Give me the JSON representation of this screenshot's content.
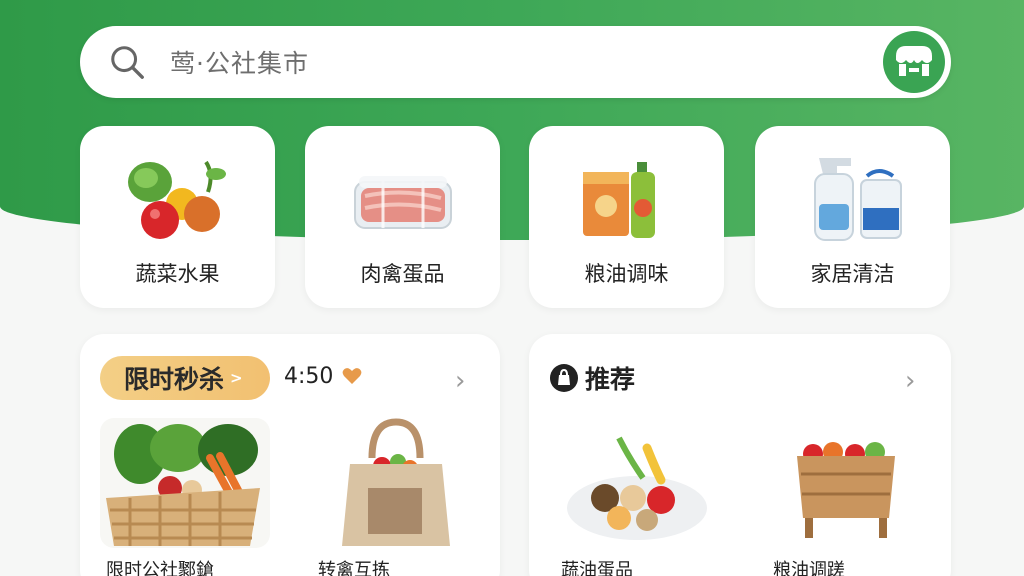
{
  "search": {
    "placeholder": "莺·公社集市",
    "icons": {
      "left": "search-icon",
      "right": "storefront-icon"
    }
  },
  "categories": [
    {
      "label": "蔬菜水果",
      "icon": "vegetables-fruits-icon"
    },
    {
      "label": "肉禽蛋品",
      "icon": "meat-tray-icon"
    },
    {
      "label": "粮油调味",
      "icon": "grain-oil-icon"
    },
    {
      "label": "家居清洁",
      "icon": "cleaning-bottles-icon"
    }
  ],
  "flash_sale": {
    "title": "限时秒杀",
    "timer": "4:50",
    "products": [
      {
        "label": "限时公社鄹鎗",
        "image": "vegetable-basket"
      },
      {
        "label": "转禽互拣",
        "image": "grocery-tote-bag"
      }
    ]
  },
  "recommend": {
    "title": "推荐",
    "products": [
      {
        "label": "蔬油蛋品",
        "image": "vegetable-plate"
      },
      {
        "label": "粮油调蹉",
        "image": "fruit-crate"
      }
    ]
  },
  "colors": {
    "brand_green": "#3ea857",
    "pill_gold": "#f2c071",
    "heart_orange": "#e79a4a"
  }
}
